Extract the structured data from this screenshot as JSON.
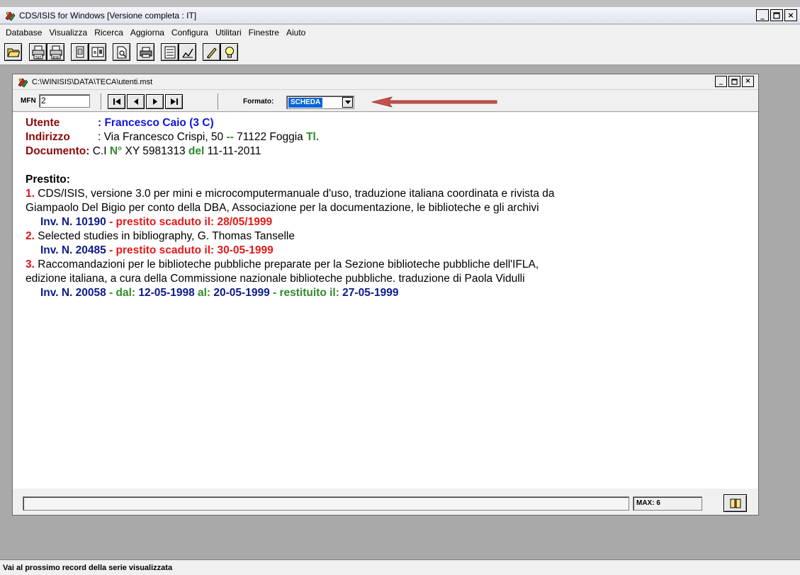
{
  "app": {
    "title": "CDS/ISIS for Windows [Versione completa : IT]"
  },
  "menu": [
    "Database",
    "Visualizza",
    "Ricerca",
    "Aggiorna",
    "Configura",
    "Utilitari",
    "Finestre",
    "Aiuto"
  ],
  "toolbar": {
    "buttons": [
      "open-folder-icon",
      "print-txt-icon",
      "print-rtf-icon",
      "copy-record-icon",
      "copy-all-icon",
      "preview-icon",
      "printer-icon",
      "form-icon",
      "edit-icon",
      "pencil-icon",
      "lightbulb-icon"
    ],
    "txt_label": "TXT",
    "rtf_label": "RTF"
  },
  "child": {
    "title": "C:\\WINISIS\\DATA\\TECA\\utenti.mst",
    "mfn_label": "MFN",
    "mfn_value": "2",
    "formato_label": "Formato:",
    "formato_value": "SCHEDA",
    "max_label": "MAX: 6"
  },
  "record": {
    "utente_label": "Utente",
    "utente_value": ": Francesco Caio (3 C)",
    "indirizzo_label": "Indirizzo",
    "indirizzo_value": ": Via Francesco Crispi, 50 ",
    "indirizzo_sep": "--",
    "indirizzo_cap": " 71122 Foggia ",
    "indirizzo_tl": "Tl.",
    "documento_label": "Documento:",
    "documento_type": " C.I ",
    "documento_n": "N°",
    "documento_num": " XY 5981313 ",
    "documento_del": "del",
    "documento_date": " 11-11-2011",
    "prestito_label": "Prestito:",
    "loans": [
      {
        "num": "1.",
        "line1": " CDS/ISIS, versione 3.0 per mini e microcomputermanuale d'uso, traduzione italiana coordinata e rivista da",
        "line2": "Giampaolo Del Bigio per conto della DBA, Associazione per la documentazione, le biblioteche e gli archivi",
        "inv": "Inv. N. 10190",
        "status": " - prestito scaduto il: 28/05/1999"
      },
      {
        "num": "2.",
        "line1": " Selected studies in bibliography, G. Thomas Tanselle",
        "inv": "Inv. N. 20485",
        "status": " - prestito scaduto il: 30-05-1999"
      },
      {
        "num": "3.",
        "line1": " Raccomandazioni per le biblioteche pubbliche preparate per la Sezione biblioteche pubbliche dell'IFLA,",
        "line2": "edizione italiana, a cura della Commissione nazionale biblioteche pubbliche. traduzione di Paola Vidulli",
        "inv": "Inv. N. 20058",
        "dal_label": " - dal: ",
        "dal_value": "12-05-1998",
        "al_label": " al: ",
        "al_value": "20-05-1999",
        "restituito_label": " - restituito il: ",
        "restituito_value": "27-05-1999"
      }
    ]
  },
  "statusbar": {
    "text": "Vai al prossimo record della serie visualizzata"
  },
  "colors": {
    "maroon": "#8b0a0a",
    "blue": "#1414e0",
    "green": "#2e8b2e",
    "navy": "#0c1b8a",
    "red": "#e21a1a",
    "mdi_bg": "#a9a9a9"
  }
}
